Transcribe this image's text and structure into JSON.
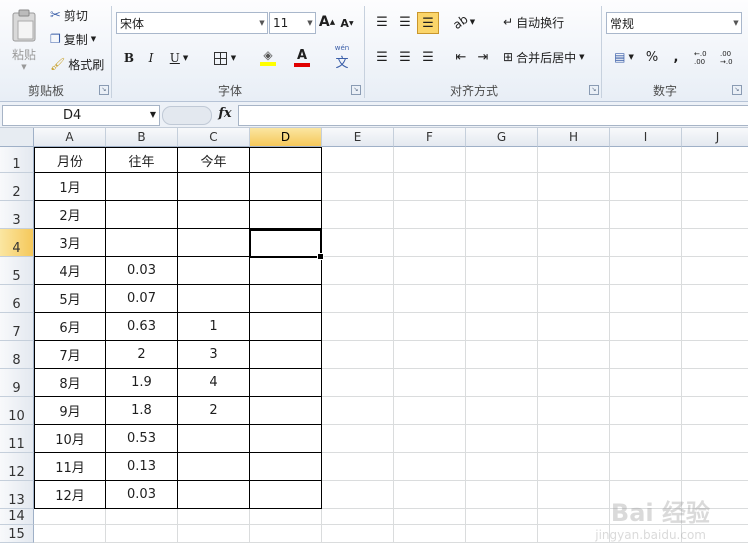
{
  "ribbon": {
    "clipboard": {
      "paste": "粘贴",
      "cut": "剪切",
      "copy": "复制",
      "format_painter": "格式刷",
      "title": "剪贴板"
    },
    "font": {
      "name": "宋体",
      "size": "11",
      "bold": "B",
      "italic": "I",
      "underline": "U",
      "title": "字体",
      "wen": "wén"
    },
    "align": {
      "wrap": "自动换行",
      "merge": "合并后居中",
      "title": "对齐方式"
    },
    "number": {
      "format": "常规",
      "percent": "%",
      "comma": ",",
      "title": "数字",
      "inc": "←.0 .00",
      "dec": ".00 →.0"
    }
  },
  "formula": {
    "namebox": "D4",
    "fx": "fx",
    "value": ""
  },
  "columns": [
    "A",
    "B",
    "C",
    "D",
    "E",
    "F",
    "G",
    "H",
    "I",
    "J"
  ],
  "rows": [
    "1",
    "2",
    "3",
    "4",
    "5",
    "6",
    "7",
    "8",
    "9",
    "10",
    "11",
    "12",
    "13",
    "14",
    "15"
  ],
  "table": {
    "headers": [
      "月份",
      "往年",
      "今年",
      ""
    ],
    "data": [
      [
        "1月",
        "",
        "",
        ""
      ],
      [
        "2月",
        "",
        "",
        ""
      ],
      [
        "3月",
        "",
        "",
        ""
      ],
      [
        "4月",
        "0.03",
        "",
        ""
      ],
      [
        "5月",
        "0.07",
        "",
        ""
      ],
      [
        "6月",
        "0.63",
        "1",
        ""
      ],
      [
        "7月",
        "2",
        "3",
        ""
      ],
      [
        "8月",
        "1.9",
        "4",
        ""
      ],
      [
        "9月",
        "1.8",
        "2",
        ""
      ],
      [
        "10月",
        "0.53",
        "",
        ""
      ],
      [
        "11月",
        "0.13",
        "",
        ""
      ],
      [
        "12月",
        "0.03",
        "",
        ""
      ]
    ]
  },
  "watermark": {
    "logo": "Bai 经验",
    "url": "jingyan.baidu.com"
  },
  "colors": {
    "active_header": "#f5c85a",
    "ribbon_border": "#b6c3d6",
    "font_color_bar": "#e00000",
    "fill_color_bar": "#ffff00"
  }
}
